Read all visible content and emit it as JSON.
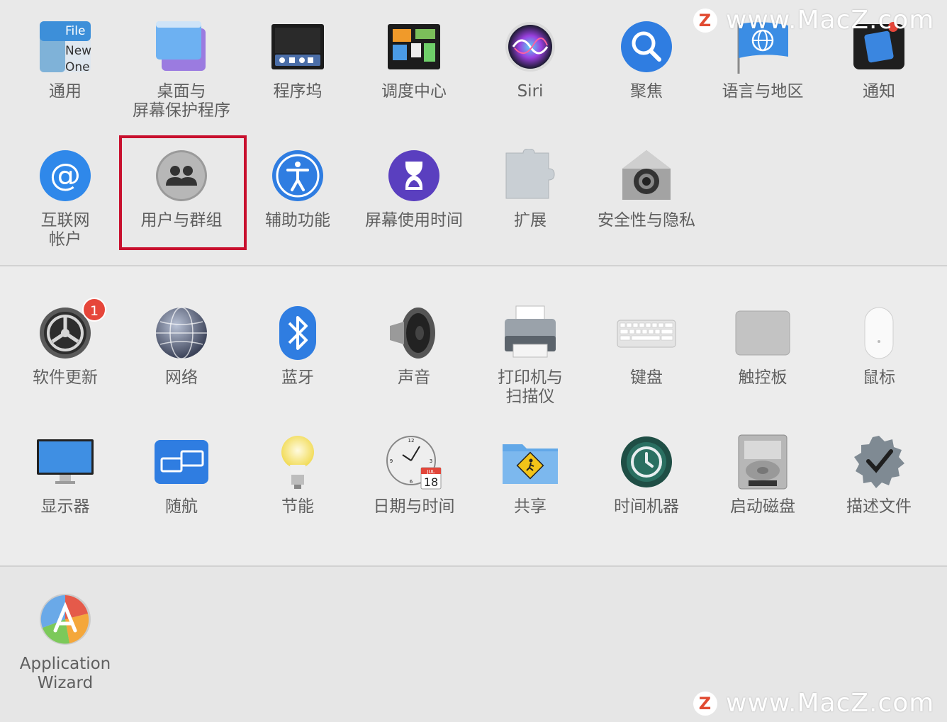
{
  "personal": [
    {
      "label": "通用",
      "icon": "general-icon"
    },
    {
      "label": "桌面与\n屏幕保护程序",
      "icon": "desktop-screensaver-icon"
    },
    {
      "label": "程序坞",
      "icon": "dock-icon"
    },
    {
      "label": "调度中心",
      "icon": "mission-control-icon"
    },
    {
      "label": "Siri",
      "icon": "siri-icon"
    },
    {
      "label": "聚焦",
      "icon": "spotlight-icon"
    },
    {
      "label": "语言与地区",
      "icon": "language-region-icon"
    },
    {
      "label": "通知",
      "icon": "notifications-icon"
    },
    {
      "label": "互联网\n帐户",
      "icon": "internet-accounts-icon"
    },
    {
      "label": "用户与群组",
      "icon": "users-groups-icon"
    },
    {
      "label": "辅助功能",
      "icon": "accessibility-icon"
    },
    {
      "label": "屏幕使用时间",
      "icon": "screen-time-icon"
    },
    {
      "label": "扩展",
      "icon": "extensions-icon"
    },
    {
      "label": "安全性与隐私",
      "icon": "security-privacy-icon"
    }
  ],
  "hardware": [
    {
      "label": "软件更新",
      "icon": "software-update-icon",
      "badge": "1"
    },
    {
      "label": "网络",
      "icon": "network-icon"
    },
    {
      "label": "蓝牙",
      "icon": "bluetooth-icon"
    },
    {
      "label": "声音",
      "icon": "sound-icon"
    },
    {
      "label": "打印机与\n扫描仪",
      "icon": "printers-scanners-icon"
    },
    {
      "label": "键盘",
      "icon": "keyboard-icon"
    },
    {
      "label": "触控板",
      "icon": "trackpad-icon"
    },
    {
      "label": "鼠标",
      "icon": "mouse-icon"
    },
    {
      "label": "显示器",
      "icon": "displays-icon"
    },
    {
      "label": "随航",
      "icon": "sidecar-icon"
    },
    {
      "label": "节能",
      "icon": "energy-saver-icon"
    },
    {
      "label": "日期与时间",
      "icon": "date-time-icon"
    },
    {
      "label": "共享",
      "icon": "sharing-icon"
    },
    {
      "label": "时间机器",
      "icon": "time-machine-icon"
    },
    {
      "label": "启动磁盘",
      "icon": "startup-disk-icon"
    },
    {
      "label": "描述文件",
      "icon": "profiles-icon"
    }
  ],
  "other": [
    {
      "label": "Application\nWizard",
      "icon": "application-wizard-icon"
    }
  ],
  "general_icon_text": [
    "File",
    "New",
    "One"
  ],
  "calendar_icon": {
    "month": "JUL",
    "day": "18"
  },
  "highlight": {
    "target": "用户与群组",
    "color": "#c8102e"
  },
  "watermark": {
    "text": "www.MacZ.com",
    "logo": "Z"
  },
  "colors": {
    "accent_blue": "#2f7de1",
    "badge_red": "#e6463a",
    "label_gray": "#5f5f5f"
  }
}
